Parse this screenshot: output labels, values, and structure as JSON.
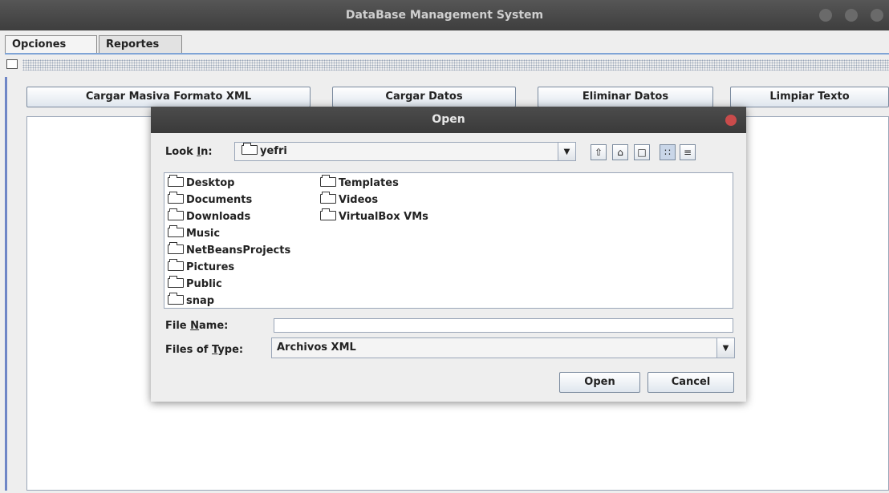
{
  "window": {
    "title": "DataBase Management System"
  },
  "tabs": [
    {
      "label": "Opciones"
    },
    {
      "label": "Reportes"
    }
  ],
  "buttons": {
    "cargar_masiva": "Cargar Masiva Formato XML",
    "cargar_datos": "Cargar Datos",
    "eliminar_datos": "Eliminar Datos",
    "limpiar_texto": "Limpiar Texto"
  },
  "dialog": {
    "title": "Open",
    "look_in_label_pre": "Look ",
    "look_in_label_u": "I",
    "look_in_label_post": "n:",
    "look_in_value": "yefri",
    "toolbar_icons": [
      "up-one-level-icon",
      "home-icon",
      "new-folder-icon",
      "list-view-icon",
      "details-view-icon"
    ],
    "files": [
      {
        "name": "Desktop"
      },
      {
        "name": "Documents"
      },
      {
        "name": "Downloads"
      },
      {
        "name": "Music"
      },
      {
        "name": "NetBeansProjects"
      },
      {
        "name": "Pictures"
      },
      {
        "name": "Public"
      },
      {
        "name": "snap"
      },
      {
        "name": "Templates"
      },
      {
        "name": "Videos"
      },
      {
        "name": "VirtualBox VMs"
      }
    ],
    "file_name_label_pre": "File ",
    "file_name_label_u": "N",
    "file_name_label_post": "ame:",
    "file_name_value": "",
    "files_of_type_label_pre": "Files of ",
    "files_of_type_label_u": "T",
    "files_of_type_label_post": "ype:",
    "files_of_type_value": "Archivos XML",
    "open_button": "Open",
    "cancel_button": "Cancel"
  },
  "colors": {
    "accent": "#7fa4d6",
    "titlebar": "#3e3e3e",
    "close": "#c94b4b"
  }
}
